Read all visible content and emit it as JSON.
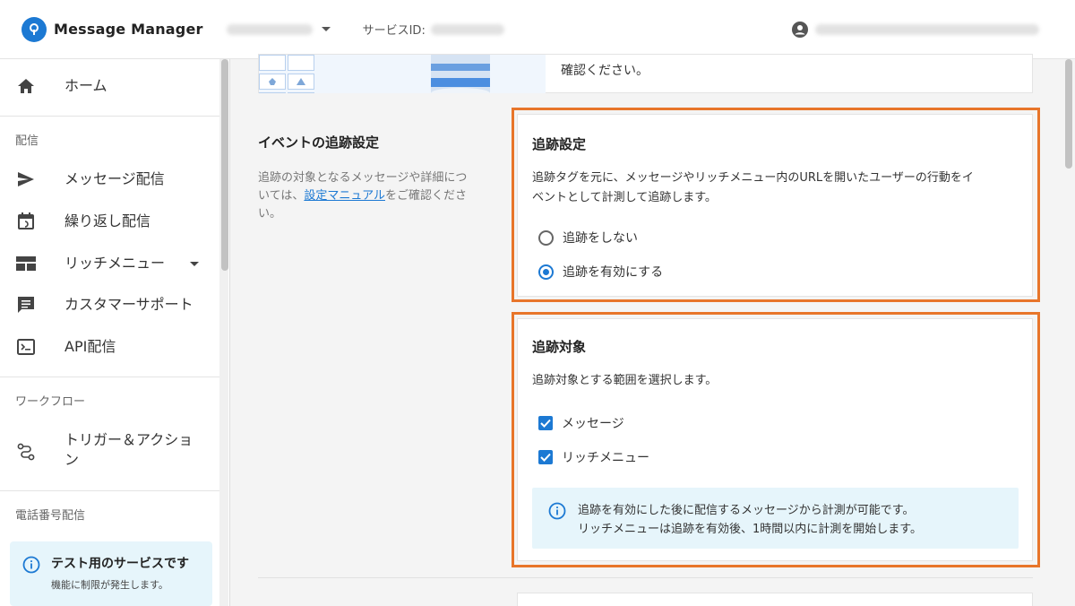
{
  "header": {
    "app_name": "Message Manager",
    "service_id_label": "サービスID:"
  },
  "sidebar": {
    "home": "ホーム",
    "section_delivery": "配信",
    "message_delivery": "メッセージ配信",
    "repeat_delivery": "繰り返し配信",
    "rich_menu": "リッチメニュー",
    "customer_support": "カスタマーサポート",
    "api_delivery": "API配信",
    "section_workflow": "ワークフロー",
    "trigger_action_line1": "トリガー＆アクショ",
    "trigger_action_line2": "ン",
    "section_phone": "電話番号配信",
    "test_title": "テスト用のサービスです",
    "test_sub": "機能に制限が発生します。"
  },
  "main": {
    "top_card_text": "確認ください。",
    "section_title": "イベントの追跡設定",
    "section_desc_line1": "追跡の対象となるメッセージや詳細につ",
    "section_desc_line2_pre": "いては、",
    "section_desc_link": "設定マニュアル",
    "section_desc_line2_post": "をご確認くださ",
    "section_desc_line3": "い。",
    "tracking_settings": {
      "title": "追跡設定",
      "desc_line1": "追跡タグを元に、メッセージやリッチメニュー内のURLを開いたユーザーの行動をイ",
      "desc_line2": "ベントとして計測して追跡します。",
      "option_off": "追跡をしない",
      "option_on": "追跡を有効にする",
      "selected": "追跡を有効にする"
    },
    "tracking_target": {
      "title": "追跡対象",
      "desc": "追跡対象とする範囲を選択します。",
      "check_message": "メッセージ",
      "check_rich_menu": "リッチメニュー",
      "info_line1": "追跡を有効にした後に配信するメッセージから計測が可能です。",
      "info_line2": "リッチメニューは追跡を有効後、1時間以内に計測を開始します。"
    }
  },
  "colors": {
    "accent": "#1c79d3",
    "highlight": "#e8752a",
    "info_bg": "#e6f5fb"
  }
}
